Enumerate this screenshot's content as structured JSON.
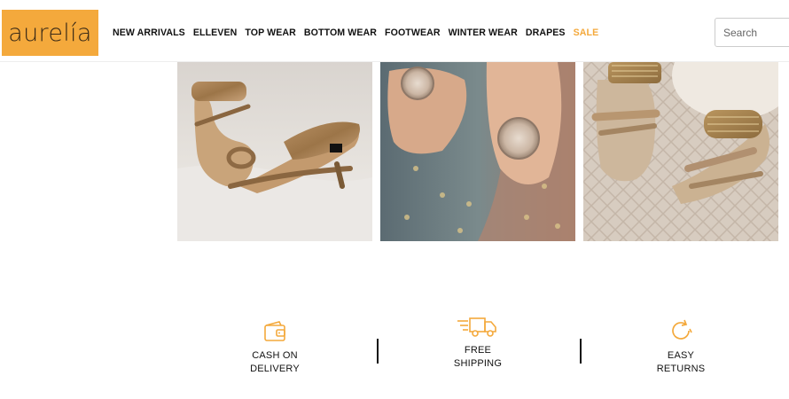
{
  "brand": {
    "logo_text": "aurelía",
    "accent": "#f4a93c"
  },
  "nav": {
    "items": [
      {
        "label": "NEW ARRIVALS"
      },
      {
        "label": "ELLEVEN"
      },
      {
        "label": "TOP WEAR"
      },
      {
        "label": "BOTTOM WEAR"
      },
      {
        "label": "FOOTWEAR"
      },
      {
        "label": "WINTER WEAR"
      },
      {
        "label": "DRAPES"
      },
      {
        "label": "SALE",
        "color": "#f4a93c"
      }
    ]
  },
  "search": {
    "placeholder": "Search"
  },
  "products": [
    {
      "image": "gold-kitten-heel-sandal"
    },
    {
      "image": "embellished-flat-sandal"
    },
    {
      "image": "gold-strappy-flat-sandal"
    }
  ],
  "features": [
    {
      "icon": "wallet-icon",
      "line1": "CASH ON",
      "line2": "DELIVERY"
    },
    {
      "icon": "truck-icon",
      "line1": "FREE",
      "line2": "SHIPPING"
    },
    {
      "icon": "refresh-icon",
      "line1": "EASY",
      "line2": "RETURNS"
    }
  ]
}
